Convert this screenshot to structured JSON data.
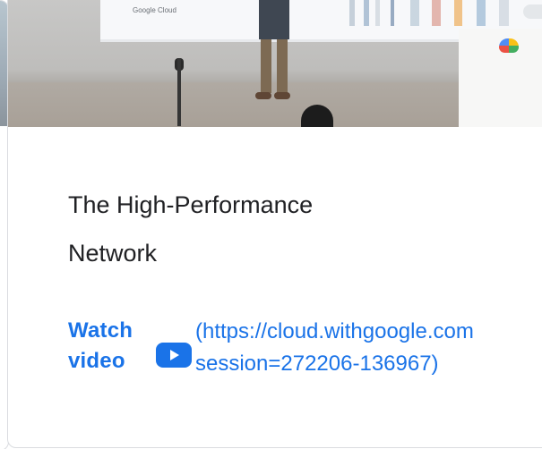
{
  "card": {
    "hero_brand": "Google Cloud",
    "title": "The High-Performance Network",
    "watch_label_line1": "Watch",
    "watch_label_line2": "video",
    "watch_url_line1": "(https://cloud.withgoogle.com",
    "watch_url_line2": "session=272206-136967)"
  },
  "colors": {
    "accent": "#1a73e8",
    "title_text": "#202124",
    "border": "#dadce0"
  },
  "icons": {
    "play": "play-icon"
  }
}
